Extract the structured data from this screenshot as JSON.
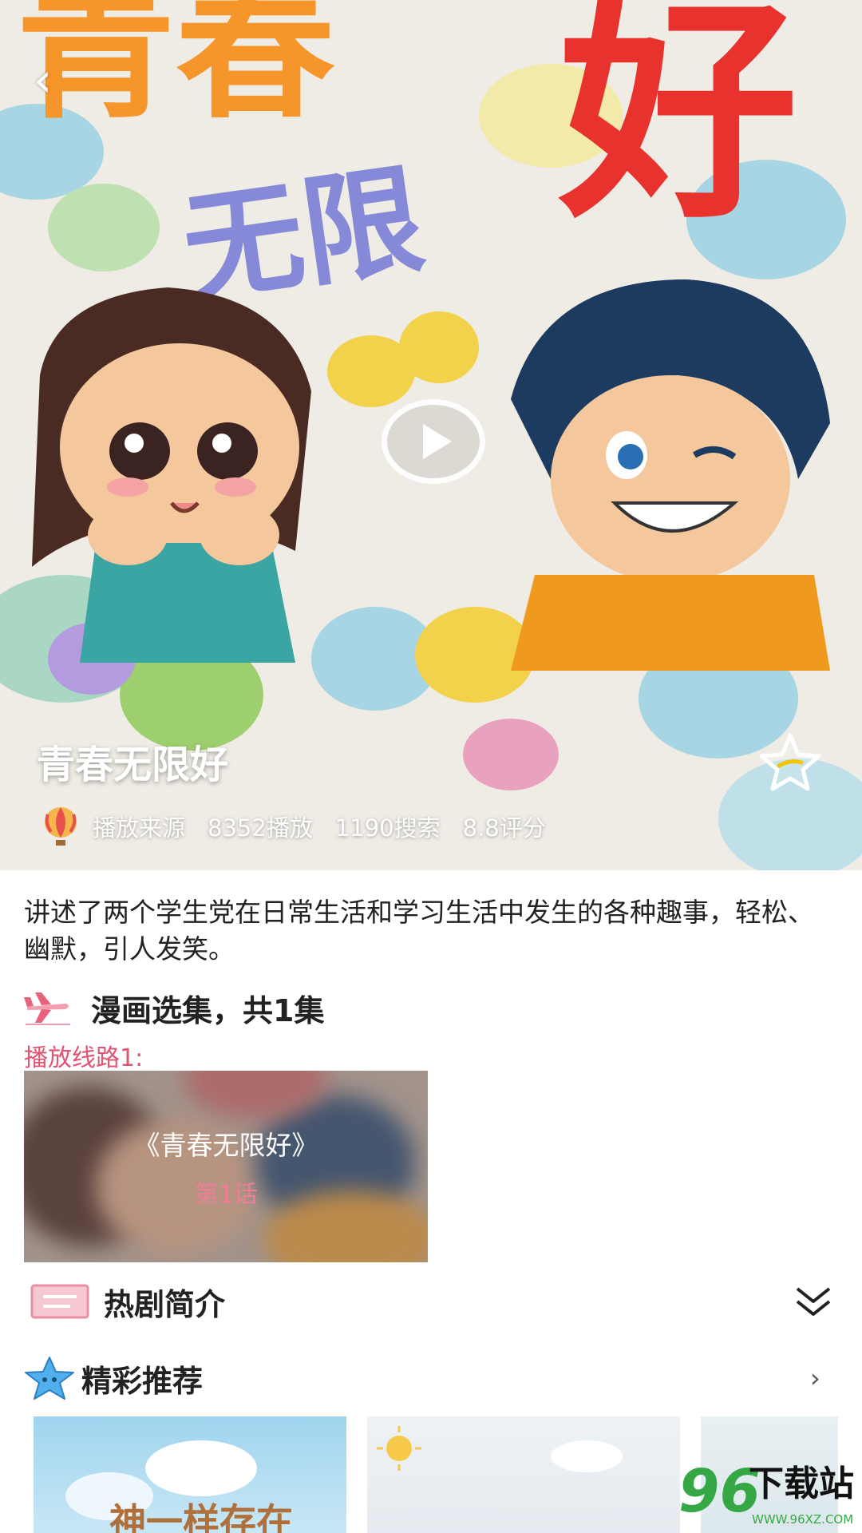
{
  "hero": {
    "title": "青春无限好",
    "stats": {
      "source": "播放来源",
      "plays": "8352播放",
      "searches": "1190搜索",
      "rating": "8.8评分"
    },
    "cover_text": {
      "qing_chun": "青春",
      "hao": "好",
      "wu_xian": "无限"
    }
  },
  "description": "讲述了两个学生党在日常生活和学习生活中发生的各种趣事，轻松、幽默，引人发笑。",
  "episodes": {
    "heading": "漫画选集，共1集",
    "route_label": "播放线路1:",
    "items": [
      {
        "title": "《青春无限好》",
        "label": "第1话"
      }
    ]
  },
  "intro": {
    "heading": "热剧简介"
  },
  "recommend": {
    "heading": "精彩推荐",
    "cards": [
      {
        "cover_text": "神一样存在"
      },
      {
        "cover_text": ""
      },
      {
        "cover_text": ""
      }
    ]
  },
  "watermark": {
    "number": "96",
    "text": "下载站",
    "url": "WWW.96XZ.COM"
  },
  "colors": {
    "accent_pink": "#e05472",
    "episode_label": "#ee7e98",
    "rating_star": "#f5c400"
  },
  "icons": [
    "back-arrow-icon",
    "play-icon",
    "star-outline-icon",
    "hot-air-balloon-icon",
    "airplane-icon",
    "envelope-icon",
    "chevron-down-icon",
    "blue-star-icon",
    "chevron-right-icon"
  ]
}
